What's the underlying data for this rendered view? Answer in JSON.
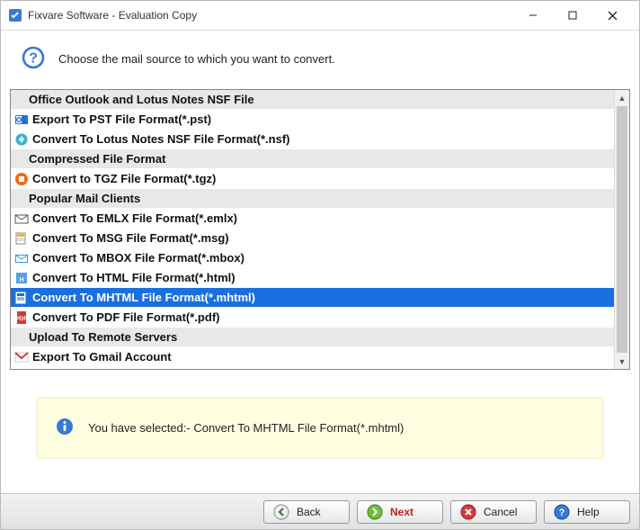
{
  "window": {
    "title": "Fixvare Software - Evaluation Copy"
  },
  "header": {
    "text": "Choose the mail source to which you want to convert."
  },
  "list": [
    {
      "type": "header",
      "label": "Office Outlook and Lotus Notes NSF File"
    },
    {
      "type": "item",
      "icon": "outlook",
      "label": "Export To PST File Format(*.pst)"
    },
    {
      "type": "item",
      "icon": "nsf",
      "label": "Convert To Lotus Notes NSF File Format(*.nsf)"
    },
    {
      "type": "header",
      "label": "Compressed File Format"
    },
    {
      "type": "item",
      "icon": "tgz",
      "label": "Convert to TGZ File Format(*.tgz)"
    },
    {
      "type": "header",
      "label": "Popular Mail Clients"
    },
    {
      "type": "item",
      "icon": "emlx",
      "label": "Convert To EMLX File Format(*.emlx)"
    },
    {
      "type": "item",
      "icon": "msg",
      "label": "Convert To MSG File Format(*.msg)"
    },
    {
      "type": "item",
      "icon": "mbox",
      "label": "Convert To MBOX File Format(*.mbox)"
    },
    {
      "type": "item",
      "icon": "html",
      "label": "Convert To HTML File Format(*.html)"
    },
    {
      "type": "item",
      "icon": "mhtml",
      "label": "Convert To MHTML File Format(*.mhtml)",
      "selected": true
    },
    {
      "type": "item",
      "icon": "pdf",
      "label": "Convert To PDF File Format(*.pdf)"
    },
    {
      "type": "header",
      "label": "Upload To Remote Servers"
    },
    {
      "type": "item",
      "icon": "gmail",
      "label": "Export To Gmail Account"
    }
  ],
  "info": {
    "message": "You have selected:- Convert To MHTML File Format(*.mhtml)"
  },
  "footer": {
    "back": "Back",
    "next": "Next",
    "cancel": "Cancel",
    "help": "Help"
  }
}
